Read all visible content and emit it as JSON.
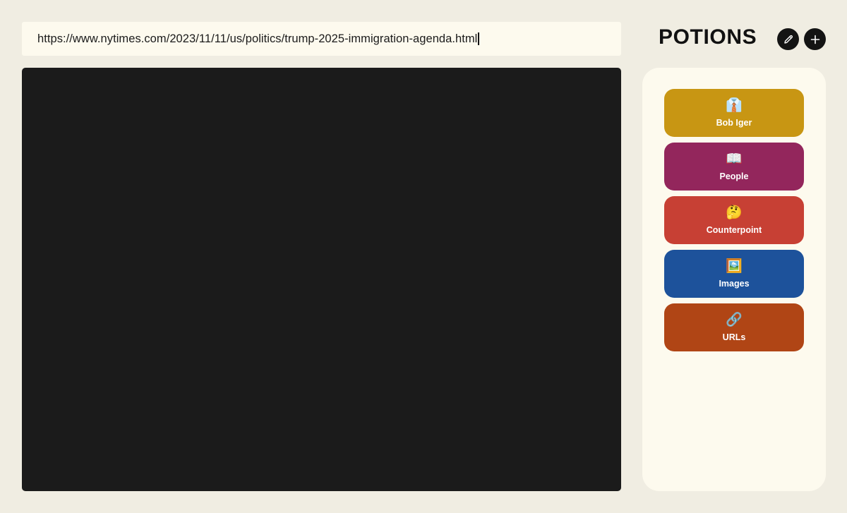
{
  "url_bar": {
    "value": "https://www.nytimes.com/2023/11/11/us/politics/trump-2025-immigration-agenda.html"
  },
  "header": {
    "title": "POTIONS"
  },
  "potions": [
    {
      "label": "Bob Iger",
      "emoji": "👔",
      "color": "#c89613"
    },
    {
      "label": "People",
      "emoji": "📖",
      "color": "#93265c"
    },
    {
      "label": "Counterpoint",
      "emoji": "🤔",
      "color": "#c74034"
    },
    {
      "label": "Images",
      "emoji": "🖼️",
      "color": "#1d529b"
    },
    {
      "label": "URLs",
      "emoji": "🔗",
      "color": "#b04515"
    }
  ],
  "icons": {
    "edit": "pencil-icon",
    "add": "plus-icon"
  },
  "colors": {
    "background": "#f0ede2",
    "panel": "#fdfaee",
    "viewer": "#1b1b1b"
  }
}
